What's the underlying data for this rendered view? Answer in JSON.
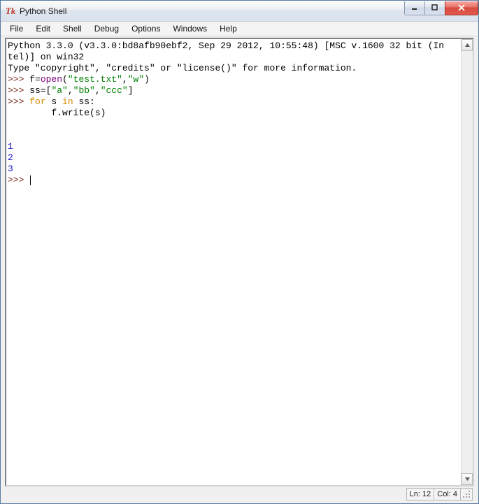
{
  "window": {
    "title": "Python Shell",
    "app_icon_name": "tk-feather-icon"
  },
  "menu": {
    "items": [
      "File",
      "Edit",
      "Shell",
      "Debug",
      "Options",
      "Windows",
      "Help"
    ]
  },
  "shell": {
    "banner_line1": "Python 3.3.0 (v3.3.0:bd8afb90ebf2, Sep 29 2012, 10:55:48) [MSC v.1600 32 bit (In",
    "banner_line2": "tel)] on win32",
    "banner_line3": "Type \"copyright\", \"credits\" or \"license()\" for more information.",
    "prompt": ">>> ",
    "line1_a": "f=",
    "line1_b": "open",
    "line1_c": "(",
    "line1_d": "\"test.txt\"",
    "line1_e": ",",
    "line1_f": "\"w\"",
    "line1_g": ")",
    "line2_a": "ss=[",
    "line2_b": "\"a\"",
    "line2_c": ",",
    "line2_d": "\"bb\"",
    "line2_e": ",",
    "line2_f": "\"ccc\"",
    "line2_g": "]",
    "line3_a": "for",
    "line3_b": " s ",
    "line3_c": "in",
    "line3_d": " ss:",
    "line4": "        f.write(s)",
    "blank": "",
    "out1": "1",
    "out2": "2",
    "out3": "3"
  },
  "status": {
    "line_label": "Ln: 12",
    "col_label": "Col: 4"
  },
  "colors": {
    "close_btn": "#d94b3f",
    "titlebar_text": "#1a1a1a"
  }
}
